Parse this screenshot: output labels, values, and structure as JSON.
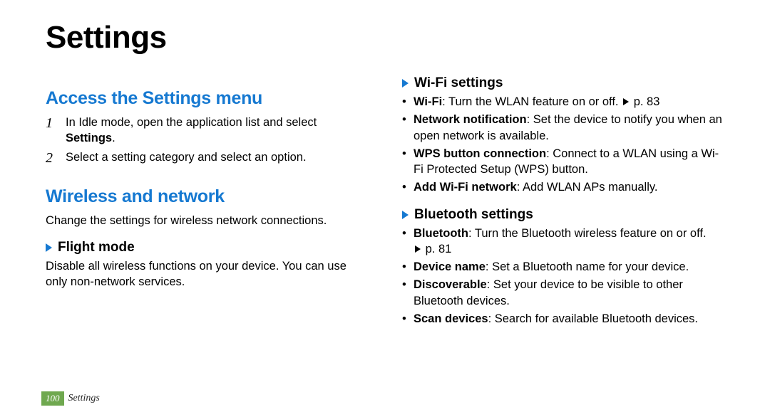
{
  "page": {
    "number": "100",
    "footer_label": "Settings",
    "title": "Settings"
  },
  "left": {
    "h_access": "Access the Settings menu",
    "steps": [
      {
        "n": "1",
        "pre": "In Idle mode, open the application list and select ",
        "bold": "Settings",
        "post": "."
      },
      {
        "n": "2",
        "pre": "Select a setting category and select an option.",
        "bold": "",
        "post": ""
      }
    ],
    "h_wireless": "Wireless and network",
    "wireless_intro": "Change the settings for wireless network connections.",
    "sub_flight": "Flight mode",
    "flight_text": "Disable all wireless functions on your device. You can use only non-network services."
  },
  "right": {
    "sub_wifi": "Wi-Fi settings",
    "wifi_items": [
      {
        "bold": "Wi-Fi",
        "text": ": Turn the WLAN feature on or off. ",
        "ref": "p. 83"
      },
      {
        "bold": "Network notification",
        "text": ": Set the device to notify you when an open network is available.",
        "ref": ""
      },
      {
        "bold": "WPS button connection",
        "text": ": Connect to a WLAN using a Wi-Fi Protected Setup (WPS) button.",
        "ref": ""
      },
      {
        "bold": "Add Wi-Fi network",
        "text": ": Add WLAN APs manually.",
        "ref": ""
      }
    ],
    "sub_bt": "Bluetooth settings",
    "bt_items": [
      {
        "bold": "Bluetooth",
        "text": ": Turn the Bluetooth wireless feature on or off. ",
        "ref": "p. 81"
      },
      {
        "bold": "Device name",
        "text": ": Set a Bluetooth name for your device.",
        "ref": ""
      },
      {
        "bold": "Discoverable",
        "text": ": Set your device to be visible to other Bluetooth devices.",
        "ref": ""
      },
      {
        "bold": "Scan devices",
        "text": ": Search for available Bluetooth devices.",
        "ref": ""
      }
    ]
  }
}
